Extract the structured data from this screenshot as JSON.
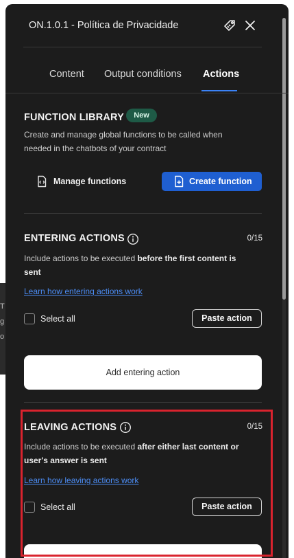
{
  "background": {
    "snippets": [
      "T",
      "g",
      "o"
    ]
  },
  "header": {
    "title": "ON.1.0.1 - Política de Privacidade",
    "tag_icon": "tag-icon",
    "close_icon": "close-icon"
  },
  "tabs": [
    {
      "label": "Content",
      "active": false
    },
    {
      "label": "Output conditions",
      "active": false
    },
    {
      "label": "Actions",
      "active": true
    }
  ],
  "function_library": {
    "title": "FUNCTION LIBRARY",
    "badge": "New",
    "description": "Create and manage global functions to be called when needed in the chatbots of your contract",
    "manage_label": "Manage functions",
    "create_label": "Create function"
  },
  "entering_actions": {
    "title": "ENTERING ACTIONS",
    "count": "0/15",
    "desc_prefix": "Include actions to be executed ",
    "desc_bold": "before the first content is sent",
    "link": "Learn how entering actions work",
    "select_all": "Select all",
    "paste_label": "Paste action",
    "add_label": "Add entering action"
  },
  "leaving_actions": {
    "title": "LEAVING ACTIONS",
    "count": "0/15",
    "desc_prefix": "Include actions to be executed ",
    "desc_bold": "after either last content or user's answer is sent",
    "link": "Learn how leaving actions work",
    "select_all": "Select all",
    "paste_label": "Paste action"
  },
  "colors": {
    "panel": "#1c1c1c",
    "accent": "#1f5fd1",
    "link": "#4c8df5",
    "highlight": "#d9232e",
    "badge": "#1e5a46"
  }
}
